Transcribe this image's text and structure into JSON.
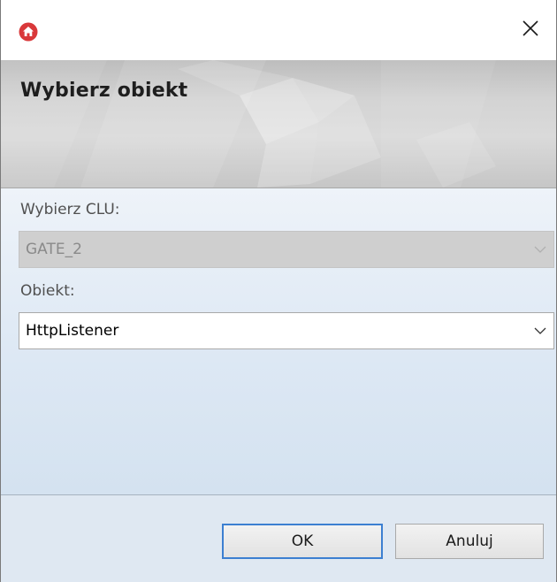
{
  "window": {
    "icon": "home-logo-icon",
    "close_icon": "close-icon"
  },
  "banner": {
    "title": "Wybierz obiekt"
  },
  "form": {
    "clu_label": "Wybierz CLU:",
    "clu_value": "GATE_2",
    "clu_disabled": true,
    "object_label": "Obiekt:",
    "object_value": "HttpListener"
  },
  "buttons": {
    "ok_label": "OK",
    "cancel_label": "Anuluj"
  },
  "colors": {
    "accent_logo": "#d9383a",
    "focus_border": "#3c7fd1"
  }
}
